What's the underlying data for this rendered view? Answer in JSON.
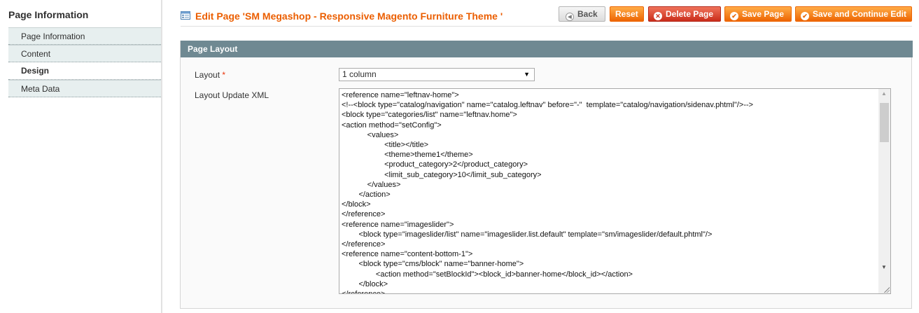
{
  "sidebar": {
    "title": "Page Information",
    "tabs": [
      {
        "label": "Page Information"
      },
      {
        "label": "Content"
      },
      {
        "label": "Design"
      },
      {
        "label": "Meta Data"
      }
    ]
  },
  "header": {
    "title": "Edit Page 'SM Megashop - Responsive Magento Furniture Theme '",
    "icon": "page-icon",
    "buttons": {
      "back": "Back",
      "reset": "Reset",
      "delete": "Delete Page",
      "save": "Save Page",
      "save_continue": "Save and Continue Edit"
    }
  },
  "fieldset": {
    "title": "Page Layout",
    "layout_label": "Layout",
    "required_mark": "*",
    "layout_value": "1 column",
    "xml_label": "Layout Update XML",
    "xml_lines": [
      "<reference name=\"leftnav-home\">",
      "<!--<block type=\"catalog/navigation\" name=\"catalog.leftnav\" before=\"-\"  template=\"catalog/navigation/sidenav.phtml\"/>-->",
      "<block type=\"categories/list\" name=\"leftnav.home\">",
      "<action method=\"setConfig\">",
      "            <values>",
      "                    <title></title>",
      "                    <theme>theme1</theme>",
      "                    <product_category>2</product_category>",
      "                    <limit_sub_category>10</limit_sub_category>",
      "            </values>",
      "        </action>",
      "</block>",
      "</reference>",
      "<reference name=\"imageslider\">",
      "        <block type=\"imageslider/list\" name=\"imageslider.list.default\" template=\"sm/imageslider/default.phtml\"/>",
      "</reference>",
      "<reference name=\"content-bottom-1\">",
      "        <block type=\"cms/block\" name=\"banner-home\">",
      "                <action method=\"setBlockId\"><block_id>banner-home</block_id></action>",
      "        </block>",
      "</reference>"
    ]
  },
  "colors": {
    "accent": "#eb5e00",
    "section_bar": "#6f8992",
    "button_orange": "#ed6502",
    "button_red": "#ca2d1b"
  }
}
